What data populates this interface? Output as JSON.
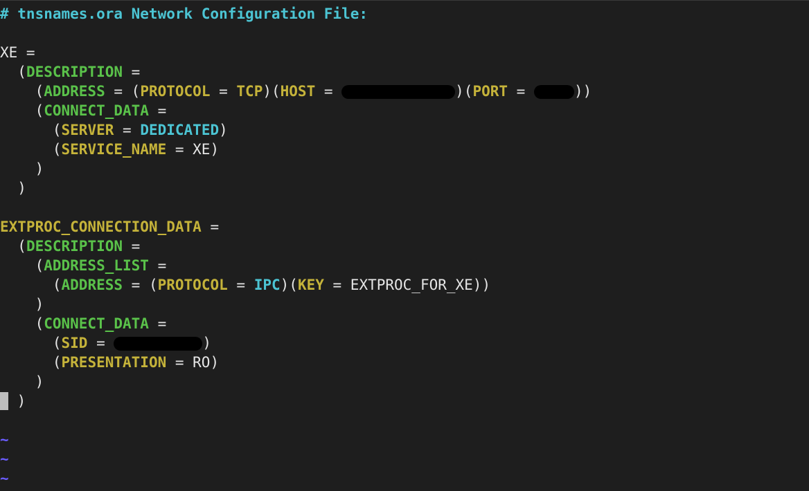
{
  "editor": {
    "lines": [
      {
        "segments": [
          {
            "cls": "comment",
            "text": "# tnsnames.ora Network Configuration File:"
          }
        ]
      },
      {
        "segments": []
      },
      {
        "segments": [
          {
            "cls": "plain",
            "text": "XE ="
          }
        ]
      },
      {
        "segments": [
          {
            "cls": "plain",
            "text": "  ("
          },
          {
            "cls": "kw",
            "text": "DESCRIPTION"
          },
          {
            "cls": "plain",
            "text": " ="
          }
        ]
      },
      {
        "segments": [
          {
            "cls": "plain",
            "text": "    ("
          },
          {
            "cls": "kw",
            "text": "ADDRESS"
          },
          {
            "cls": "plain",
            "text": " = ("
          },
          {
            "cls": "key",
            "text": "PROTOCOL"
          },
          {
            "cls": "plain",
            "text": " = "
          },
          {
            "cls": "key",
            "text": "TCP"
          },
          {
            "cls": "plain",
            "text": ")("
          },
          {
            "cls": "key",
            "text": "HOST"
          },
          {
            "cls": "plain",
            "text": " = "
          },
          {
            "cls": "redact",
            "text": "",
            "width": 164,
            "name": "host-redaction"
          },
          {
            "cls": "plain",
            "text": ")("
          },
          {
            "cls": "key",
            "text": "PORT"
          },
          {
            "cls": "plain",
            "text": " = "
          },
          {
            "cls": "redact",
            "text": "",
            "width": 58,
            "name": "port-redaction"
          },
          {
            "cls": "plain",
            "text": "))"
          }
        ]
      },
      {
        "segments": [
          {
            "cls": "plain",
            "text": "    ("
          },
          {
            "cls": "kw",
            "text": "CONNECT_DATA"
          },
          {
            "cls": "plain",
            "text": " ="
          }
        ]
      },
      {
        "segments": [
          {
            "cls": "plain",
            "text": "      ("
          },
          {
            "cls": "key",
            "text": "SERVER"
          },
          {
            "cls": "plain",
            "text": " = "
          },
          {
            "cls": "val",
            "text": "DEDICATED"
          },
          {
            "cls": "plain",
            "text": ")"
          }
        ]
      },
      {
        "segments": [
          {
            "cls": "plain",
            "text": "      ("
          },
          {
            "cls": "key",
            "text": "SERVICE_NAME"
          },
          {
            "cls": "plain",
            "text": " = XE)"
          }
        ]
      },
      {
        "segments": [
          {
            "cls": "plain",
            "text": "    )"
          }
        ]
      },
      {
        "segments": [
          {
            "cls": "plain",
            "text": "  )"
          }
        ]
      },
      {
        "segments": []
      },
      {
        "segments": [
          {
            "cls": "key",
            "text": "EXTPROC_CONNECTION_DATA"
          },
          {
            "cls": "plain",
            "text": " ="
          }
        ]
      },
      {
        "segments": [
          {
            "cls": "plain",
            "text": "  ("
          },
          {
            "cls": "kw",
            "text": "DESCRIPTION"
          },
          {
            "cls": "plain",
            "text": " ="
          }
        ]
      },
      {
        "segments": [
          {
            "cls": "plain",
            "text": "    ("
          },
          {
            "cls": "kw",
            "text": "ADDRESS_LIST"
          },
          {
            "cls": "plain",
            "text": " ="
          }
        ]
      },
      {
        "segments": [
          {
            "cls": "plain",
            "text": "      ("
          },
          {
            "cls": "kw",
            "text": "ADDRESS"
          },
          {
            "cls": "plain",
            "text": " = ("
          },
          {
            "cls": "key",
            "text": "PROTOCOL"
          },
          {
            "cls": "plain",
            "text": " = "
          },
          {
            "cls": "val",
            "text": "IPC"
          },
          {
            "cls": "plain",
            "text": ")("
          },
          {
            "cls": "key",
            "text": "KEY"
          },
          {
            "cls": "plain",
            "text": " = EXTPROC_FOR_XE))"
          }
        ]
      },
      {
        "segments": [
          {
            "cls": "plain",
            "text": "    )"
          }
        ]
      },
      {
        "segments": [
          {
            "cls": "plain",
            "text": "    ("
          },
          {
            "cls": "kw",
            "text": "CONNECT_DATA"
          },
          {
            "cls": "plain",
            "text": " ="
          }
        ]
      },
      {
        "segments": [
          {
            "cls": "plain",
            "text": "      ("
          },
          {
            "cls": "key",
            "text": "SID"
          },
          {
            "cls": "plain",
            "text": " = "
          },
          {
            "cls": "redact",
            "text": "",
            "width": 128,
            "name": "sid-redaction"
          },
          {
            "cls": "plain",
            "text": ")"
          }
        ]
      },
      {
        "segments": [
          {
            "cls": "plain",
            "text": "      ("
          },
          {
            "cls": "key",
            "text": "PRESENTATION"
          },
          {
            "cls": "plain",
            "text": " = RO)"
          }
        ]
      },
      {
        "segments": [
          {
            "cls": "plain",
            "text": "    )"
          }
        ]
      },
      {
        "segments": [
          {
            "cls": "cursor",
            "text": ""
          },
          {
            "cls": "plain",
            "text": " )"
          }
        ]
      },
      {
        "segments": []
      },
      {
        "segments": [
          {
            "cls": "tilde",
            "text": "~"
          }
        ]
      },
      {
        "segments": [
          {
            "cls": "tilde",
            "text": "~"
          }
        ]
      },
      {
        "segments": [
          {
            "cls": "tilde",
            "text": "~"
          }
        ]
      }
    ]
  }
}
